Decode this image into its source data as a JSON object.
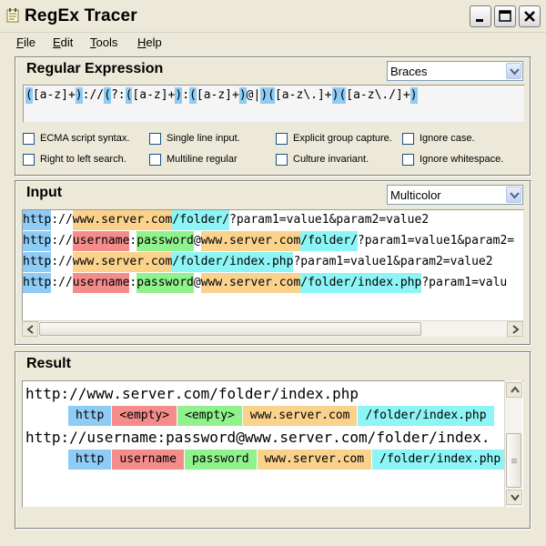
{
  "window": {
    "title": "RegEx Tracer",
    "icon": "notepad-icon",
    "controls": [
      "minimize-icon",
      "maximize-icon",
      "close-icon"
    ]
  },
  "menu": [
    {
      "label": "File",
      "underline": "F"
    },
    {
      "label": "Edit",
      "underline": "E"
    },
    {
      "label": "Tools",
      "underline": "T"
    },
    {
      "label": "Help",
      "underline": "H"
    }
  ],
  "regex_panel": {
    "title": "Regular Expression",
    "mode": "Braces",
    "expression_parts": [
      {
        "text": "(",
        "color": "blue"
      },
      {
        "text": "[a-z]+",
        "color": "none"
      },
      {
        "text": ")",
        "color": "blue"
      },
      {
        "text": "://",
        "color": "none"
      },
      {
        "text": "(",
        "color": "blue"
      },
      {
        "text": "?:",
        "color": "none"
      },
      {
        "text": "(",
        "color": "blue"
      },
      {
        "text": "[a-z]+",
        "color": "none"
      },
      {
        "text": ")",
        "color": "blue"
      },
      {
        "text": ":",
        "color": "none"
      },
      {
        "text": "(",
        "color": "blue"
      },
      {
        "text": "[a-z]+",
        "color": "none"
      },
      {
        "text": ")",
        "color": "blue"
      },
      {
        "text": "@|",
        "color": "none"
      },
      {
        "text": ")",
        "color": "blue"
      },
      {
        "text": "(",
        "color": "blue"
      },
      {
        "text": "[a-z\\.]+",
        "color": "none"
      },
      {
        "text": ")",
        "color": "blue"
      },
      {
        "text": "(",
        "color": "blue"
      },
      {
        "text": "[a-z\\./]+",
        "color": "none"
      },
      {
        "text": ")",
        "color": "blue"
      }
    ],
    "options": [
      {
        "label": "ECMA script syntax.",
        "checked": false
      },
      {
        "label": "Single line input.",
        "checked": false
      },
      {
        "label": "Explicit group capture.",
        "checked": false
      },
      {
        "label": "Ignore case.",
        "checked": false
      },
      {
        "label": "Right to left search.",
        "checked": false
      },
      {
        "label": "Multiline regular",
        "checked": false
      },
      {
        "label": "Culture invariant.",
        "checked": false
      },
      {
        "label": "Ignore whitespace.",
        "checked": false
      }
    ]
  },
  "input_panel": {
    "title": "Input",
    "mode": "Multicolor",
    "lines": [
      [
        {
          "text": "http",
          "color": "blue"
        },
        {
          "text": "://",
          "color": "none"
        },
        {
          "text": "www.server.com",
          "color": "orange"
        },
        {
          "text": "/folder/",
          "color": "cyan"
        },
        {
          "text": "?param1=value1&param2=value2",
          "color": "none"
        }
      ],
      [
        {
          "text": "http",
          "color": "blue"
        },
        {
          "text": "://",
          "color": "none"
        },
        {
          "text": "username",
          "color": "red"
        },
        {
          "text": ":",
          "color": "none"
        },
        {
          "text": "password",
          "color": "green"
        },
        {
          "text": "@",
          "color": "none"
        },
        {
          "text": "www.server.com",
          "color": "orange"
        },
        {
          "text": "/folder/",
          "color": "cyan"
        },
        {
          "text": "?param1=value1&param2=",
          "color": "none"
        }
      ],
      [
        {
          "text": "http",
          "color": "blue"
        },
        {
          "text": "://",
          "color": "none"
        },
        {
          "text": "www.server.com",
          "color": "orange"
        },
        {
          "text": "/folder/index.php",
          "color": "cyan"
        },
        {
          "text": "?param1=value1&param2=value2",
          "color": "none"
        }
      ],
      [
        {
          "text": "http",
          "color": "blue"
        },
        {
          "text": "://",
          "color": "none"
        },
        {
          "text": "username",
          "color": "red"
        },
        {
          "text": ":",
          "color": "none"
        },
        {
          "text": "password",
          "color": "green"
        },
        {
          "text": "@",
          "color": "none"
        },
        {
          "text": "www.server.com",
          "color": "orange"
        },
        {
          "text": "/folder/index.php",
          "color": "cyan"
        },
        {
          "text": "?param1=valu",
          "color": "none"
        }
      ]
    ]
  },
  "result_panel": {
    "title": "Result",
    "matches": [
      {
        "text": "http://www.server.com/folder/index.php",
        "groups": [
          {
            "text": "http",
            "color": "blue"
          },
          {
            "text": "<empty>",
            "color": "red"
          },
          {
            "text": "<empty>",
            "color": "green"
          },
          {
            "text": "www.server.com",
            "color": "orange"
          },
          {
            "text": "/folder/index.php",
            "color": "cyan"
          }
        ]
      },
      {
        "text": "http://username:password@www.server.com/folder/index.",
        "groups": [
          {
            "text": "http",
            "color": "blue"
          },
          {
            "text": "username",
            "color": "red"
          },
          {
            "text": "password",
            "color": "green"
          },
          {
            "text": "www.server.com",
            "color": "orange"
          },
          {
            "text": "/folder/index.php",
            "color": "cyan"
          }
        ]
      }
    ]
  },
  "colors": {
    "blue": "#8ecbf5",
    "orange": "#fad28c",
    "cyan": "#8df5f5",
    "red": "#f58c8c",
    "green": "#90f28c"
  }
}
